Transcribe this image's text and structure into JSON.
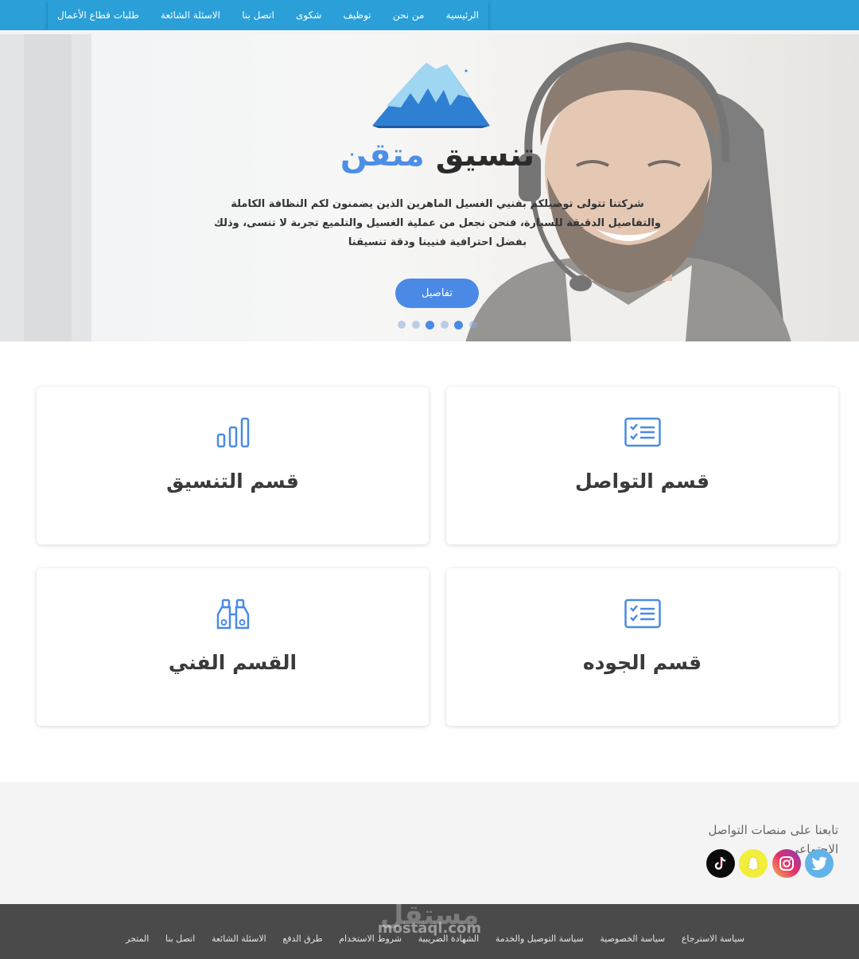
{
  "nav": {
    "items": [
      {
        "label": "الرئيسية"
      },
      {
        "label": "من نحن"
      },
      {
        "label": "توظيف"
      },
      {
        "label": "شكوى"
      },
      {
        "label": "اتصل بنا"
      },
      {
        "label": "الاسئلة الشائعة"
      },
      {
        "label": "طلبات قطاع الأعمال"
      }
    ],
    "bar_color": "#2a9fd8"
  },
  "hero": {
    "title_main": "تنسيق",
    "title_accent": "متقن",
    "description": "شركتنا تتولى توصيلكم بفنيي الغسيل الماهرين الذين يضمنون لكم النظافة الكاملة والتفاصيل الدقيقة للسيارة، فنحن نجعل من عملية الغسيل والتلميع تجربة لا تنسى، وذلك بفضل احترافية فنيينا ودقة تنسيقنا",
    "button_label": "تفاصيل",
    "slide_count": 6,
    "active_slides": [
      2,
      4
    ],
    "accent_color": "#4d8ee6"
  },
  "cards": [
    {
      "title": "قسم التواصل",
      "icon": "checklist-icon"
    },
    {
      "title": "قسم التنسيق",
      "icon": "bar-chart-icon"
    },
    {
      "title": "قسم الجوده",
      "icon": "checklist-icon"
    },
    {
      "title": "القسم الفني",
      "icon": "binoculars-icon"
    }
  ],
  "follow": {
    "title": "تابعنا على منصات التواصل الاجتماعي",
    "socials": [
      {
        "name": "twitter-icon"
      },
      {
        "name": "instagram-icon"
      },
      {
        "name": "snapchat-icon"
      },
      {
        "name": "tiktok-icon"
      }
    ]
  },
  "footer": {
    "links": [
      {
        "label": "سياسة الاسترجاع"
      },
      {
        "label": "سياسة الخصوصية"
      },
      {
        "label": "سياسة التوصيل والخدمة"
      },
      {
        "label": "الشهادة الضريبية"
      },
      {
        "label": "شروط الاستخدام"
      },
      {
        "label": "طرق الدفع"
      },
      {
        "label": "الاسئلة الشائعة"
      },
      {
        "label": "اتصل بنا"
      },
      {
        "label": "المتجر"
      }
    ],
    "watermark_text": "mostaql.com",
    "watermark_arabic": "مستقل"
  }
}
